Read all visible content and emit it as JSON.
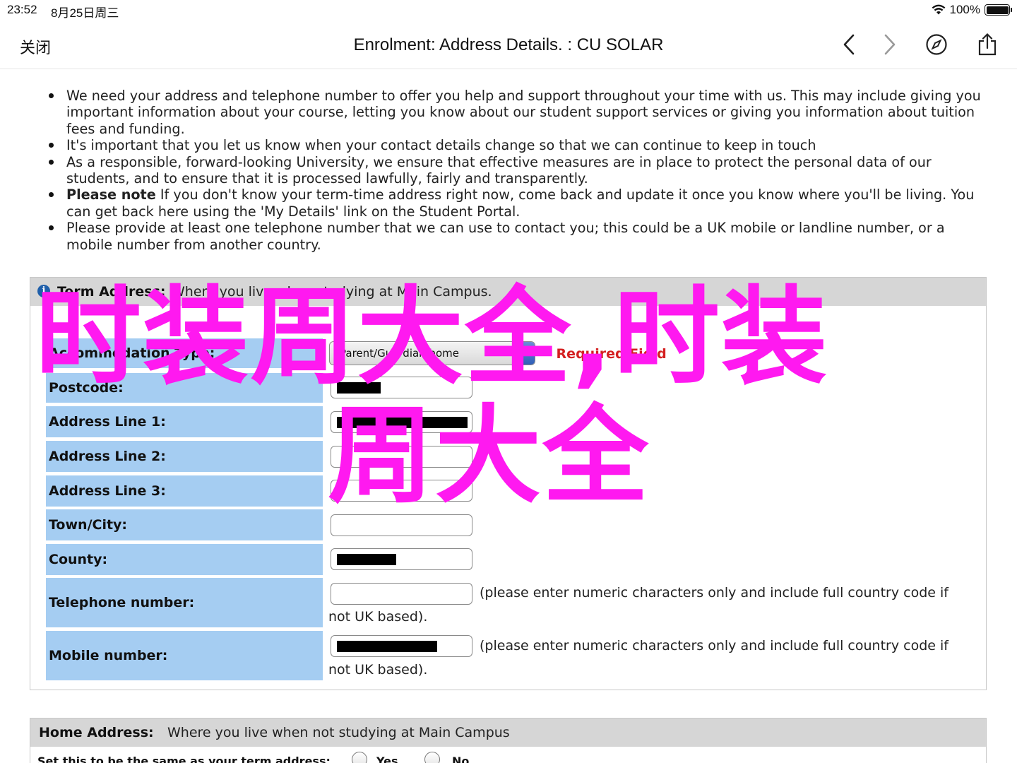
{
  "status_bar": {
    "time": "23:52",
    "date": "8月25日周三",
    "battery": "100%",
    "battery_level": 1.0
  },
  "nav": {
    "close_label": "关闭",
    "title": "Enrolment: Address Details. : CU SOLAR",
    "icons": [
      "back-arrow-icon",
      "forward-arrow-icon",
      "compass-icon",
      "share-icon"
    ]
  },
  "intro": {
    "bullets": [
      {
        "bold": "",
        "text": "We need your address and telephone number to offer you help and support throughout your time with us. This may include giving you important information about your course, letting you know about our student support services or giving you information about tuition fees and funding."
      },
      {
        "bold": "",
        "text": "It's important that you let us know when your contact details change so that we can continue to keep in touch"
      },
      {
        "bold": "",
        "text": "As a responsible, forward-looking University, we ensure that effective measures are in place to protect the personal data of our students, and to ensure that it is processed lawfully, fairly and transparently."
      },
      {
        "bold": "Please note",
        "text": " If you don't know your term-time address right now, come back and update it once you know where you'll be living. You can get back here using the 'My Details' link on the Student Portal."
      },
      {
        "bold": "",
        "text": "Please provide at least one telephone number that we can use to contact you; this could be a UK mobile or landline number, or a mobile number from another country."
      }
    ]
  },
  "term_address": {
    "title": "Term Address:",
    "description": "Where you live when studying at Main Campus.",
    "accommodation_label": "Accommodation Type:",
    "accommodation_value": "Parent/Guardian home",
    "required_text": "* Required Field",
    "labels": {
      "postcode": "Postcode:",
      "line1": "Address Line 1:",
      "line2": "Address Line 2:",
      "line3": "Address Line 3:",
      "town": "Town/City:",
      "county": "County:",
      "telephone": "Telephone number:",
      "mobile": "Mobile number:"
    },
    "phone_hint_1": "(please enter numeric characters only and include full country code if",
    "phone_hint_2": "not UK based).",
    "info_icon": "info-icon"
  },
  "home_address": {
    "title": "Home Address:",
    "description": "Where you live when not studying at Main Campus",
    "same_label": "Set this to be the same as your term address:",
    "yes": "Yes",
    "no": "No"
  },
  "watermark": {
    "line1": "时装周大全,时装",
    "line2": "周大全"
  },
  "colors": {
    "label_bg": "#a5cdf2",
    "header_bg": "#d6d6d6",
    "required": "#d42020",
    "watermark": "#ff19f0"
  }
}
